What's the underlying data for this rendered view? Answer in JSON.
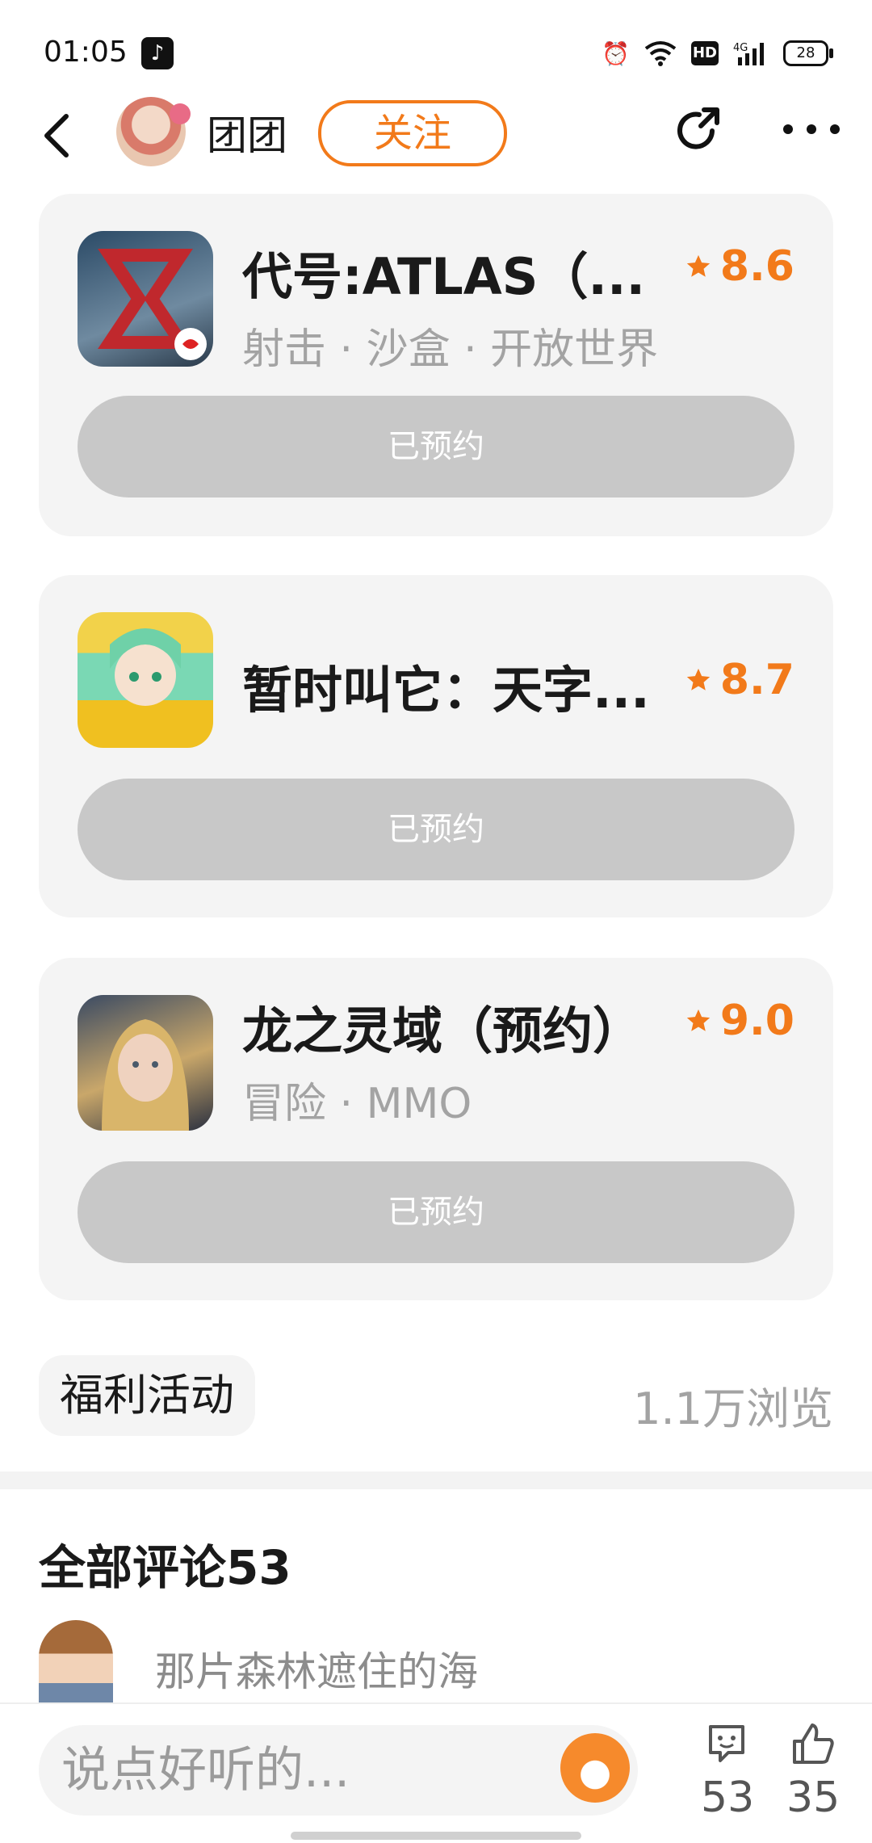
{
  "status_bar": {
    "time": "01:05",
    "battery": "28",
    "network": "4G",
    "hd": "HD"
  },
  "header": {
    "username": "团团",
    "follow_label": "关注"
  },
  "games": [
    {
      "name": "代号:ATLAS（...",
      "tags": "射击 · 沙盒 · 开放世界",
      "rating": "8.6",
      "button": "已预约"
    },
    {
      "name": "暂时叫它：天字...",
      "tags": "",
      "rating": "8.7",
      "button": "已预约"
    },
    {
      "name": "龙之灵域（预约）",
      "tags": "冒险 · MMO",
      "rating": "9.0",
      "button": "已预约"
    }
  ],
  "post_footer": {
    "tag": "福利活动",
    "views": "1.1万浏览"
  },
  "comments": {
    "title": "全部评论53",
    "first_commenter": "那片森林遮住的海"
  },
  "bottom_bar": {
    "input_placeholder": "说点好听的...",
    "comment_count": "53",
    "like_count": "35"
  },
  "colors": {
    "accent": "#f27a1a",
    "card_bg": "#f4f4f4",
    "button_bg": "#c8c8c8"
  },
  "icons": [
    "tiktok-icon",
    "alarm-icon",
    "wifi-icon",
    "signal-icon",
    "battery-icon",
    "back-icon",
    "share-icon",
    "more-icon",
    "star-icon",
    "comment-icon",
    "like-icon",
    "mascot-icon"
  ]
}
